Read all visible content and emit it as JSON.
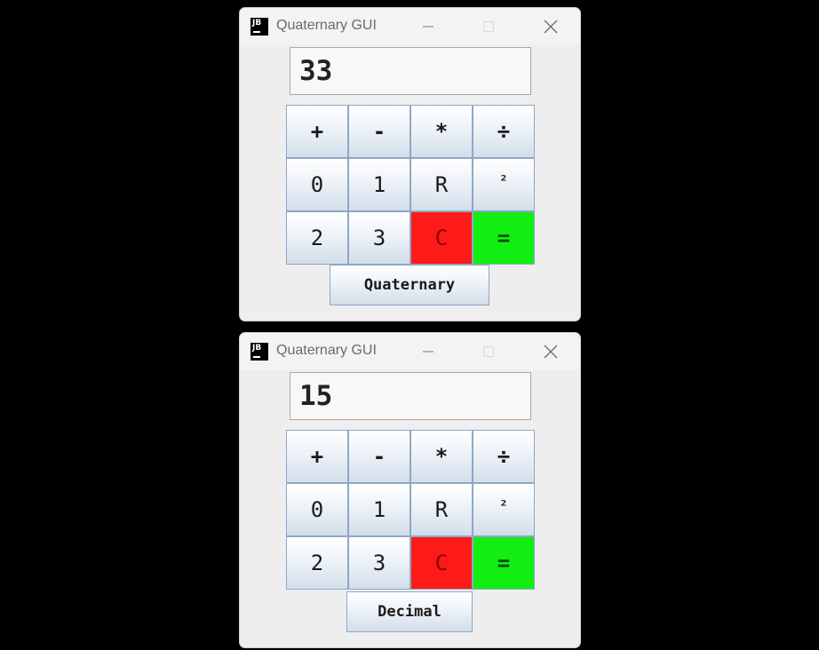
{
  "windows": [
    {
      "title": "Quaternary GUI",
      "display_value": "33",
      "keys": [
        "+",
        "-",
        "*",
        "÷",
        "0",
        "1",
        "R",
        "²",
        "2",
        "3",
        "C",
        "="
      ],
      "mode_button": "Quaternary"
    },
    {
      "title": "Quaternary GUI",
      "display_value": "15",
      "keys": [
        "+",
        "-",
        "*",
        "÷",
        "0",
        "1",
        "R",
        "²",
        "2",
        "3",
        "C",
        "="
      ],
      "mode_button": "Decimal"
    }
  ],
  "app_icon_text": "JB",
  "colors": {
    "clear_key": "#ff1a1a",
    "equals_key": "#12ee12",
    "window_bg": "#eeeeee",
    "page_bg": "#000000"
  },
  "icons": {
    "app": "jetbrains-icon",
    "minimize": "minimize-icon",
    "maximize": "maximize-icon",
    "close": "close-icon"
  }
}
